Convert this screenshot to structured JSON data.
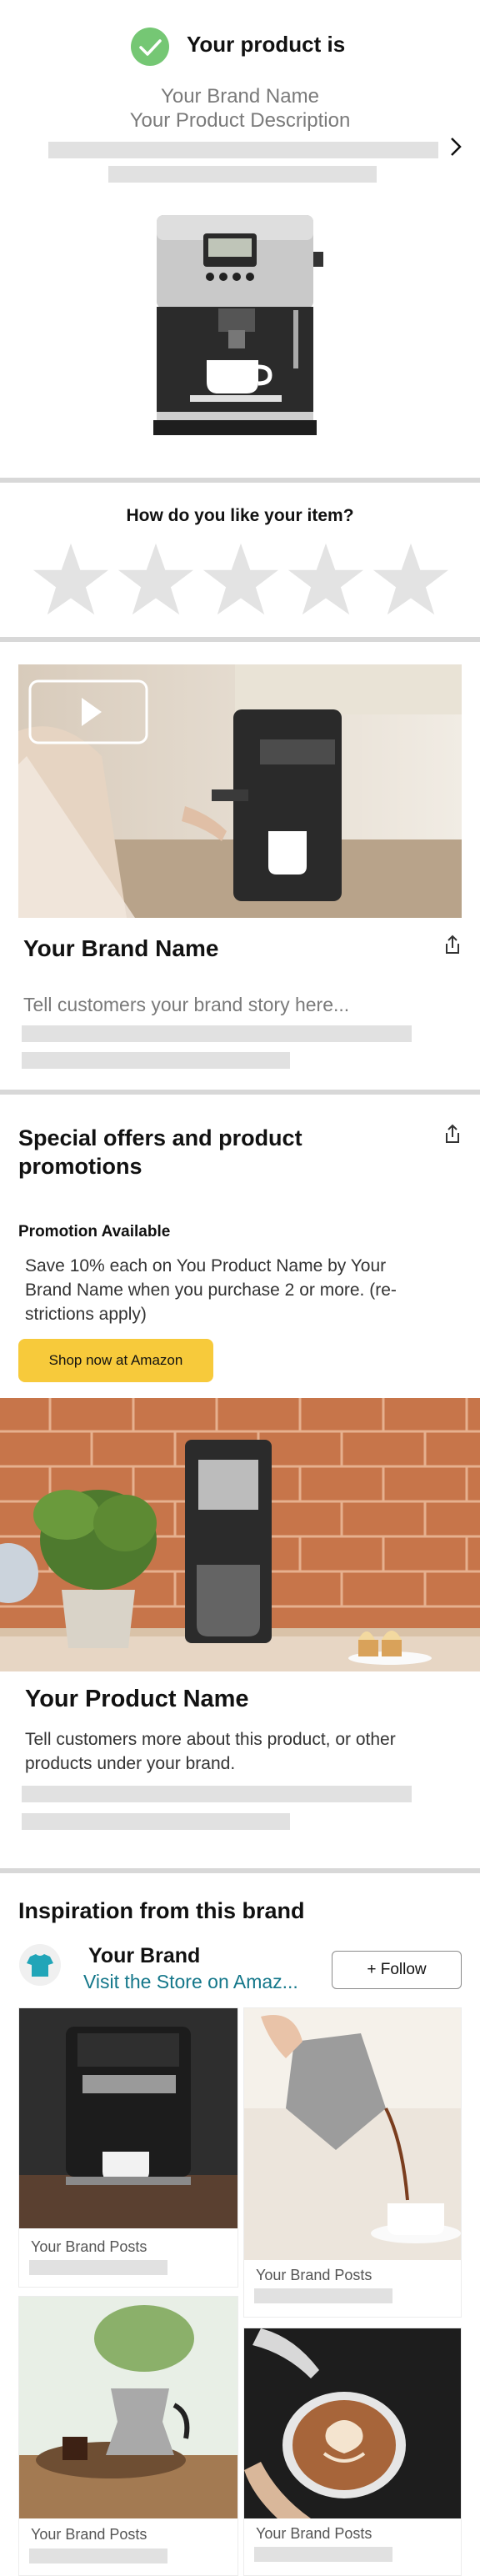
{
  "header": {
    "title": "Your product is",
    "brand": "Your Brand Name",
    "description": "Your Product Description"
  },
  "rating": {
    "question": "How do you like your item?",
    "stars": 0,
    "max_stars": 5
  },
  "brand_story": {
    "title": "Your Brand Name",
    "placeholder": "Tell customers your brand story here..."
  },
  "offers": {
    "title": "Special offers and product promotions",
    "promo_label": "Promotion Available",
    "promo_text": "Save 10% each on You Product Name by Your Brand Name when you purchase 2 or more. (re-strictions apply)",
    "cta": "Shop now at Amazon"
  },
  "product": {
    "title": "Your Product Name",
    "text": "Tell customers more about this product, or other products under your brand."
  },
  "inspiration": {
    "title": "Inspiration from this brand",
    "brand": "Your Brand",
    "link": "Visit the Store on Amaz...",
    "follow": "+ Follow",
    "posts": [
      {
        "label": "Your Brand Posts"
      },
      {
        "label": "Your Brand Posts"
      },
      {
        "label": "Your Brand Posts"
      },
      {
        "label": "Your Brand Posts"
      }
    ]
  },
  "colors": {
    "accent_green": "#75c774",
    "cta_yellow": "#f7ca3b",
    "link_teal": "#14778a",
    "brand_logo": "#21a5b8"
  }
}
